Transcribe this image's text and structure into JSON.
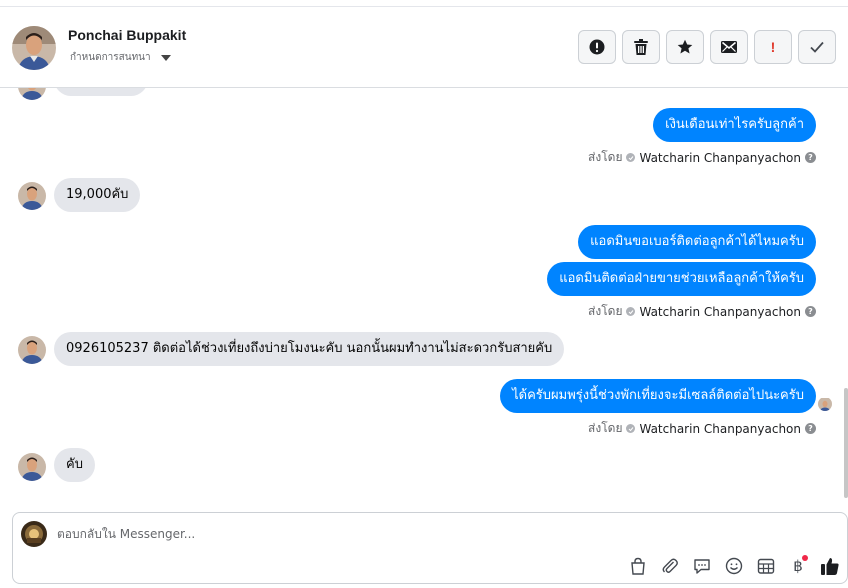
{
  "header": {
    "contact_name": "Ponchai Buppakit",
    "assign_label": "กำหนดการสนทนา",
    "toolbar": [
      {
        "name": "spam",
        "icon": "alert-circle-icon"
      },
      {
        "name": "delete",
        "icon": "trash-icon"
      },
      {
        "name": "star",
        "icon": "star-icon"
      },
      {
        "name": "mark-unread",
        "icon": "envelope-icon"
      },
      {
        "name": "follow-up",
        "icon": "exclamation-icon",
        "text": "!"
      },
      {
        "name": "done",
        "icon": "check-icon"
      }
    ]
  },
  "messages": {
    "m1": "เงินเดือนเท่าไรครับลูกค้า",
    "m2": "19,000คับ",
    "m3": "แอดมินขอเบอร์ติดต่อลูกค้าได้ไหมครับ",
    "m4": "แอดมินติดต่อฝ่ายขายช่วยเหลือลูกค้าให้ครับ",
    "m5": "0926105237 ติดต่อได้ช่วงเที่ยงถึงบ่ายโมงนะคับ นอกนั้นผมทำงานไม่สะดวกรับสายคับ",
    "m6": "ได้ครับผมพรุ่งนี้ช่วงพักเที่ยงจะมีเซลล์ติดต่อไปนะครับ",
    "m7": "คับ"
  },
  "sent_by": {
    "prefix": "ส่งโดย",
    "name": "Watcharin Chanpanyachon",
    "help": "?"
  },
  "composer": {
    "placeholder": "ตอบกลับใน Messenger...",
    "baht_symbol": "฿"
  },
  "colors": {
    "outgoing_bubble": "#0084ff",
    "incoming_bubble": "#e4e6eb",
    "notification_dot": "#f02849"
  }
}
